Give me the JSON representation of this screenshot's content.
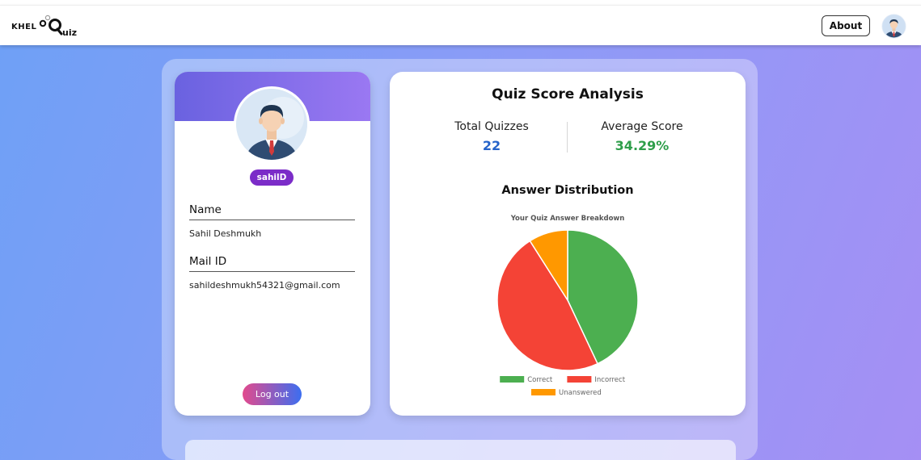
{
  "nav": {
    "logo_left": "KHEL",
    "logo_right": "uiz",
    "about_label": "About"
  },
  "profile": {
    "username": "sahilD",
    "name_label": "Name",
    "name_value": "Sahil Deshmukh",
    "mail_label": "Mail ID",
    "mail_value": "sahildeshmukh54321@gmail.com",
    "logout_label": "Log out"
  },
  "analysis": {
    "title": "Quiz Score Analysis",
    "total_label": "Total Quizzes",
    "total_value": "22",
    "average_label": "Average Score",
    "average_value": "34.29%",
    "distribution_title": "Answer Distribution"
  },
  "colors": {
    "total_value": "#2563c9",
    "average_value": "#2e9e4a",
    "correct": "#4caf50",
    "incorrect": "#f44336",
    "unanswered": "#ff9800"
  },
  "chart_data": {
    "type": "pie",
    "title": "Your Quiz Answer Breakdown",
    "categories": [
      "Correct",
      "Incorrect",
      "Unanswered"
    ],
    "values": [
      43,
      48,
      9
    ],
    "colors": [
      "#4caf50",
      "#f44336",
      "#ff9800"
    ],
    "legend_position": "bottom"
  }
}
